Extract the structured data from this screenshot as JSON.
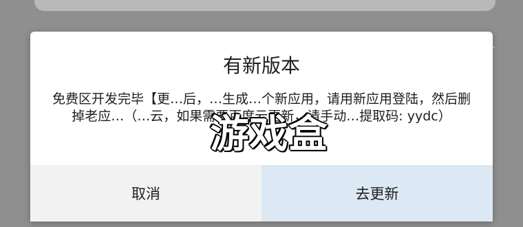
{
  "dialog": {
    "title": "有新版本",
    "message": "免费区开发完毕【更…后，…生成…个新应用，请用新应用登陆，然后删掉老应…（…云，如果需要百度云更新，请手动…提取码: yydc）",
    "watermark": "游戏盒",
    "buttons": {
      "cancel": "取消",
      "update": "去更新"
    }
  },
  "edge_marker": "+",
  "colors": {
    "backdrop": "#8f8f8f",
    "dialog_background": "#ffffff",
    "cancel_background": "#f2f2f2",
    "update_background": "#dce8f4"
  }
}
